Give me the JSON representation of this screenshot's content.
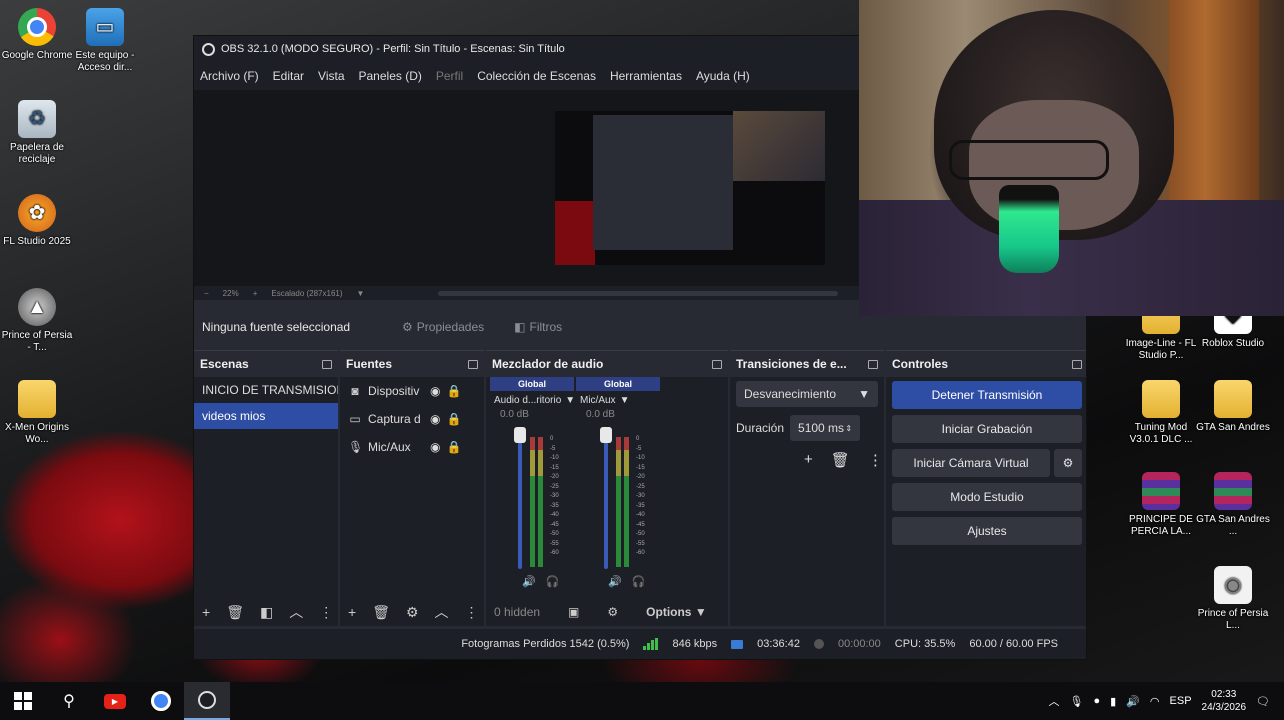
{
  "desktop": {
    "icons_left": [
      {
        "label": "Google Chrome",
        "glyph": "chrome-icon"
      },
      {
        "label": "Este equipo - Acceso dir...",
        "glyph": "computer-icon"
      },
      {
        "label": "Papelera de reciclaje",
        "glyph": "recycle-bin-icon"
      },
      {
        "label": "FL Studio 2025",
        "glyph": "fl-studio-icon"
      },
      {
        "label": "Prince of Persia - T...",
        "glyph": "game-icon"
      },
      {
        "label": "X-Men Origins Wo...",
        "glyph": "folder-icon"
      }
    ],
    "icons_right": [
      {
        "label": "Image-Line - FL Studio P...",
        "glyph": "folder-icon"
      },
      {
        "label": "Roblox Studio",
        "glyph": "roblox-icon"
      },
      {
        "label": "Tuning Mod V3.0.1 DLC ...",
        "glyph": "folder-icon"
      },
      {
        "label": "GTA San Andres",
        "glyph": "folder-icon"
      },
      {
        "label": "PRINCIPE DE PERCIA LA...",
        "glyph": "winrar-icon"
      },
      {
        "label": "GTA San Andres ...",
        "glyph": "winrar-icon"
      },
      {
        "label": "Prince of Persia L...",
        "glyph": "file-icon"
      }
    ]
  },
  "obs": {
    "title": "OBS 32.1.0 (MODO SEGURO) - Perfil: Sin Título - Escenas: Sin Título",
    "menu": [
      "Archivo (F)",
      "Editar",
      "Vista",
      "Paneles (D)",
      "Perfil",
      "Colección de Escenas",
      "Herramientas",
      "Ayuda (H)"
    ],
    "preview_bar": {
      "zoom": "22%",
      "scale": "Escalado (287x161)"
    },
    "no_source": "Ninguna fuente seleccionad",
    "properties_btn": "Propiedades",
    "filters_btn": "Filtros",
    "scenes": {
      "title": "Escenas",
      "items": [
        "INICIO DE TRANSMISION",
        "videos mios"
      ]
    },
    "sources": {
      "title": "Fuentes",
      "items": [
        {
          "name": "Dispositiv",
          "icon": "camera-icon"
        },
        {
          "name": "Captura d",
          "icon": "monitor-icon"
        },
        {
          "name": "Mic/Aux",
          "icon": "microphone-icon"
        }
      ]
    },
    "mixer": {
      "title": "Mezclador de audio",
      "channels": [
        {
          "global": "Global",
          "name": "Audio d...ritorio",
          "db": "0.0 dB"
        },
        {
          "global": "Global",
          "name": "Mic/Aux",
          "db": "0.0 dB"
        }
      ],
      "scale": [
        "0",
        "-5",
        "-10",
        "-15",
        "-20",
        "-25",
        "-30",
        "-35",
        "-40",
        "-45",
        "-50",
        "-55",
        "-60"
      ],
      "hidden": "0 hidden",
      "options": "Options"
    },
    "transitions": {
      "title": "Transiciones de e...",
      "type": "Desvanecimiento",
      "duration_label": "Duración",
      "duration_value": "5100 ms"
    },
    "controls": {
      "title": "Controles",
      "buttons": [
        "Detener Transmisión",
        "Iniciar Grabación",
        "Iniciar Cámara Virtual",
        "Modo Estudio",
        "Ajustes"
      ]
    },
    "status": {
      "dropped": "Fotogramas Perdidos 1542 (0.5%)",
      "bitrate": "846 kbps",
      "stream_time": "03:36:42",
      "rec_time": "00:00:00",
      "cpu": "CPU: 35.5%",
      "fps": "60.00 / 60.00 FPS"
    }
  },
  "taskbar": {
    "apps": [
      "start-icon",
      "search-icon",
      "youtube-icon",
      "chrome-icon",
      "obs-icon"
    ],
    "lang": "ESP",
    "time": "02:33",
    "date": "24/3/2026"
  },
  "colors": {
    "accent": "#2e4da5",
    "obs_bg": "#272a33",
    "dock_bg": "#1d1f26",
    "meter_green": "#3fbf4a"
  }
}
